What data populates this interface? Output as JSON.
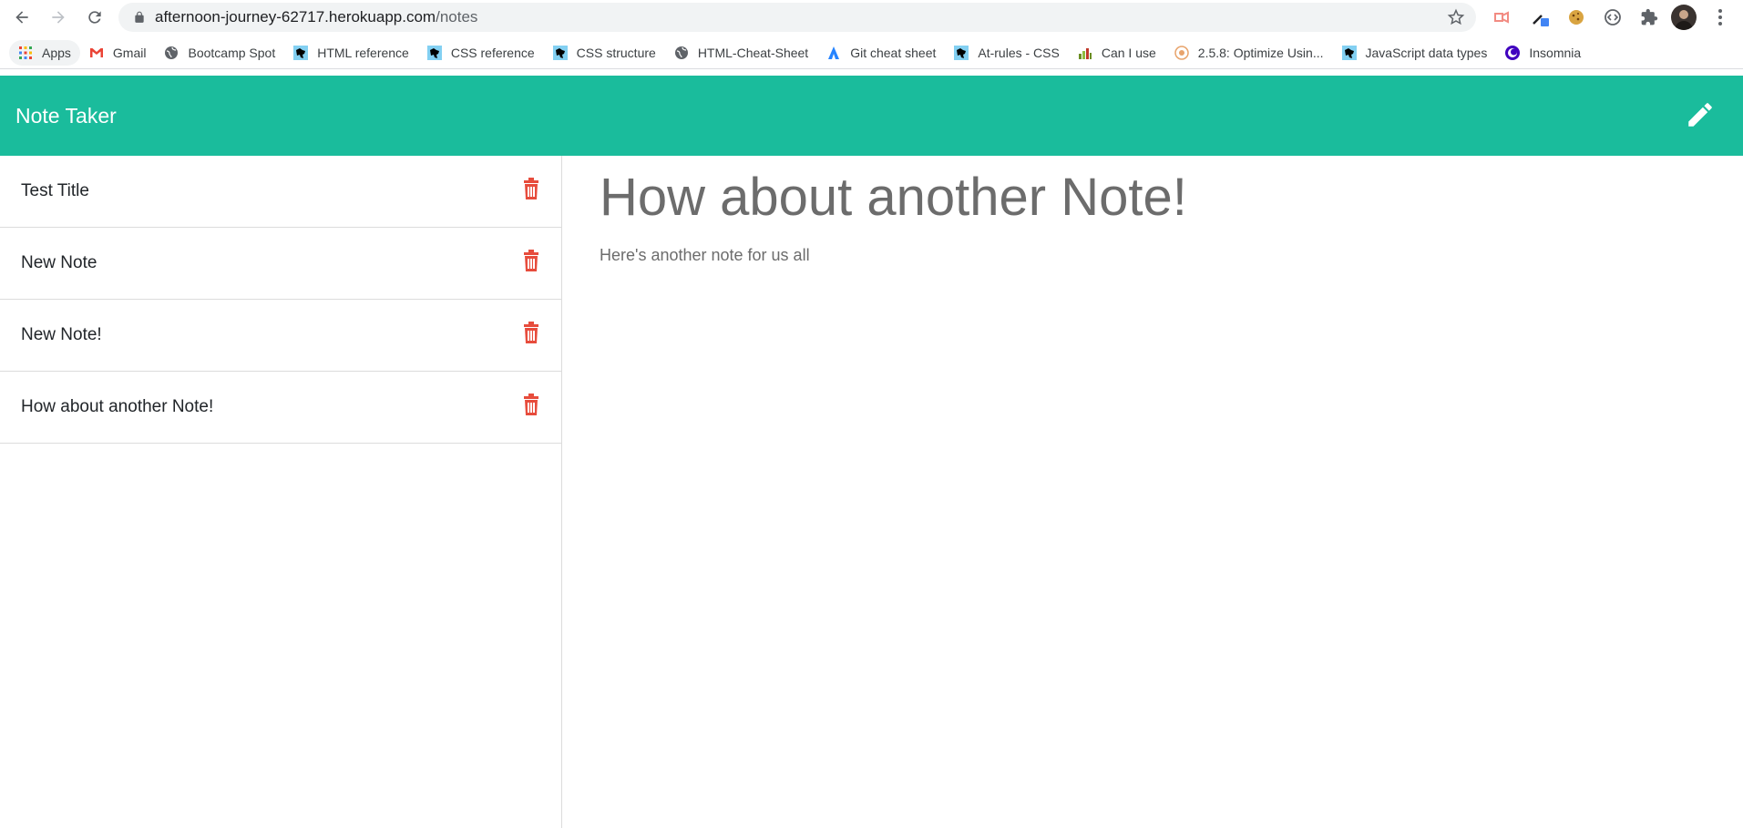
{
  "browser": {
    "url_host": "afternoon-journey-62717.herokuapp.com",
    "url_path": "/notes",
    "bookmarks": [
      {
        "label": "Apps",
        "icon": "apps-grid-icon"
      },
      {
        "label": "Gmail",
        "icon": "gmail-icon"
      },
      {
        "label": "Bootcamp Spot",
        "icon": "globe-icon"
      },
      {
        "label": "HTML reference",
        "icon": "mdn-icon"
      },
      {
        "label": "CSS reference",
        "icon": "mdn-icon"
      },
      {
        "label": "CSS structure",
        "icon": "mdn-icon"
      },
      {
        "label": "HTML-Cheat-Sheet",
        "icon": "globe-icon"
      },
      {
        "label": "Git cheat sheet",
        "icon": "atlassian-icon"
      },
      {
        "label": "At-rules - CSS",
        "icon": "mdn-icon"
      },
      {
        "label": "Can I use",
        "icon": "caniuse-icon"
      },
      {
        "label": "2.5.8: Optimize Usin...",
        "icon": "optimize-icon"
      },
      {
        "label": "JavaScript data types",
        "icon": "mdn-icon"
      },
      {
        "label": "Insomnia",
        "icon": "insomnia-icon"
      }
    ]
  },
  "app": {
    "title": "Note Taker",
    "accent_color": "#1abc9c",
    "delete_color": "#e74c3c"
  },
  "notes": [
    {
      "title": "Test Title"
    },
    {
      "title": "New Note"
    },
    {
      "title": "New Note!"
    },
    {
      "title": "How about another Note!"
    }
  ],
  "active_note": {
    "title": "How about another Note!",
    "text": "Here's another note for us all"
  }
}
